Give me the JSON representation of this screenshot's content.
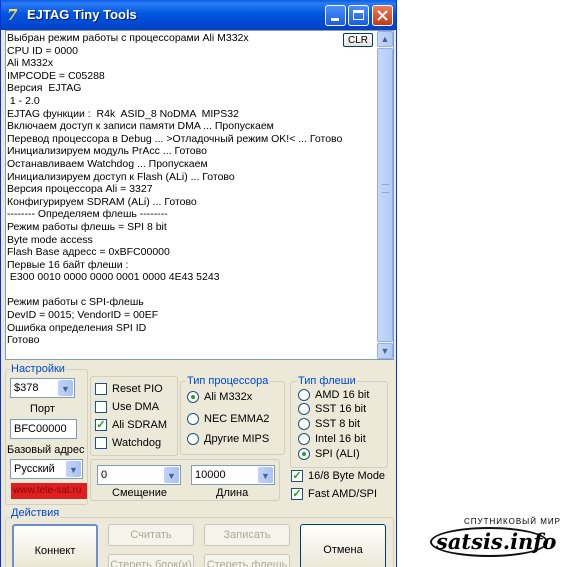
{
  "window": {
    "title": "EJTAG Tiny Tools",
    "buttons": {
      "minimize": "_",
      "maximize": "□",
      "close": "×"
    }
  },
  "log": {
    "clr_label": "CLR",
    "lines": [
      "Выбран режим работы с процессорами Ali M332x",
      "CPU ID = 0000",
      "Ali M332x",
      "IMPCODE = C05288",
      "Версия  EJTAG",
      " 1 - 2.0",
      "EJTAG функции :  R4k  ASID_8 NoDMA  MIPS32",
      "Включаем доступ к записи памяти DMA ... Пропускаем",
      "Перевод процессора в Debug ... >Отладочный режим OK!< ... Готово",
      "Инициализируем модуль PrAcc ... Готово",
      "Останавливаем Watchdog ... Пропускаем",
      "Инициализируем доступ к Flash (ALi) ... Готово",
      "Версия процессора Ali = 3327",
      "Конфигурируем SDRAM (ALi) ... Готово",
      "-------- Определяем флешь --------",
      "Режим работы флешь = SPI 8 bit",
      "Byte mode access",
      "Flash Base адресс = 0xBFC00000",
      "Первые 16 байт флеши :",
      " E300 0010 0000 0000 0001 0000 4E43 5243",
      "",
      "Режим работы с SPI-флешь",
      "DevID = 0015; VendorID = 00EF",
      "Ошибка определения SPI ID",
      "Готово"
    ]
  },
  "settings": {
    "title": "Настройки",
    "port_value": "$378",
    "port_label": "Порт",
    "base_address_value": "BFC00000",
    "base_address_label": "Базовый адрес",
    "language_value": "Русский",
    "site_text": "www.tele-sat.ru",
    "checkboxes": [
      {
        "label": "Reset PIO",
        "checked": false
      },
      {
        "label": "Use DMA",
        "checked": false
      },
      {
        "label": "Ali SDRAM",
        "checked": true
      },
      {
        "label": "Watchdog",
        "checked": false
      }
    ],
    "offset_value": "0",
    "offset_label": "Смещение",
    "length_value": "10000",
    "length_label": "Длина"
  },
  "cpu_type": {
    "title": "Тип процессора",
    "options": [
      {
        "label": "Ali M332x",
        "selected": true
      },
      {
        "label": "NEC EMMA2",
        "selected": false
      },
      {
        "label": "Другие MIPS",
        "selected": false
      }
    ]
  },
  "flash_type": {
    "title": "Тип флеши",
    "options": [
      {
        "label": "AMD 16 bit",
        "selected": false
      },
      {
        "label": "SST  16 bit",
        "selected": false
      },
      {
        "label": "SST    8 bit",
        "selected": false
      },
      {
        "label": "Intel 16 bit",
        "selected": false
      },
      {
        "label": "SPI  (ALI)",
        "selected": true
      }
    ],
    "checkboxes": [
      {
        "label": "16/8 Byte Mode",
        "checked": true
      },
      {
        "label": "Fast AMD/SPI",
        "checked": true
      }
    ]
  },
  "actions": {
    "title": "Действия",
    "connect": "Коннект",
    "read": "Считать",
    "write": "Записать",
    "erase_block": "Стереть блок(и)",
    "erase_flash": "Стереть флешь",
    "cancel": "Отмена"
  },
  "watermark": {
    "top_text": "СПУТНИКОВЫЙ МИР",
    "brand": "satsis.info"
  }
}
